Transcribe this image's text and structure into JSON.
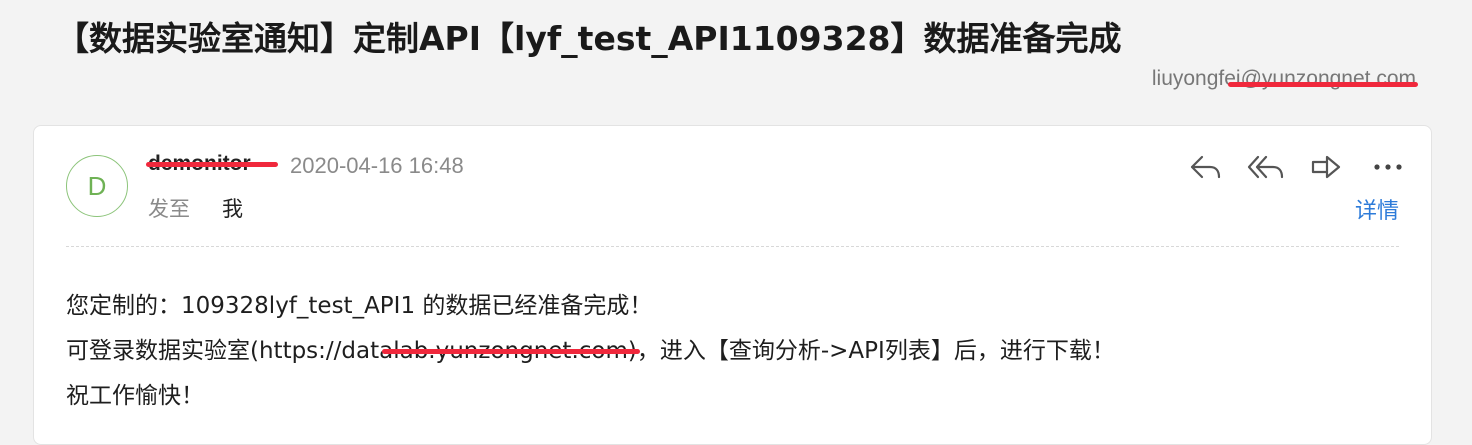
{
  "email": {
    "subject": "【数据实验室通知】定制API【lyf_test_API1109328】数据准备完成",
    "account_email": "liuyongfei@yunzongnet.com",
    "sender": {
      "avatar_letter": "D",
      "name": "demonitor",
      "timestamp": "2020-04-16 16:48"
    },
    "recipient": {
      "label": "发至",
      "value": "我"
    },
    "actions": {
      "reply_icon": "reply-icon",
      "reply_all_icon": "reply-all-icon",
      "forward_icon": "forward-icon",
      "more_icon": "more-icon",
      "details_label": "详情"
    },
    "body": {
      "line1": "您定制的：109328lyf_test_API1 的数据已经准备完成！",
      "line2": "可登录数据实验室(https://datalab.yunzongnet.com)，进入【查询分析->API列表】后，进行下载！",
      "line3": "祝工作愉快！"
    }
  },
  "colors": {
    "accent_link": "#2d7bd9",
    "avatar_green": "#6fb255",
    "redaction": "#f0283c"
  }
}
